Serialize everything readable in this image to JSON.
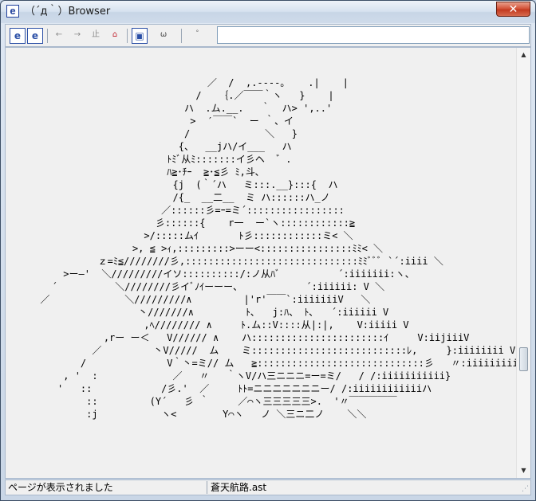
{
  "window": {
    "app_icon_glyph": "e",
    "title": "（´д｀）Browser",
    "close_glyph": "✕"
  },
  "toolbar": {
    "buttons": [
      {
        "name": "page-icon-1",
        "glyph": "e"
      },
      {
        "name": "page-icon-2",
        "glyph": "e"
      },
      {
        "name": "back-icon",
        "glyph": "←"
      },
      {
        "name": "forward-icon",
        "glyph": "→"
      },
      {
        "name": "stop-icon",
        "glyph": "止"
      },
      {
        "name": "home-icon",
        "glyph": "⌂"
      },
      {
        "name": "window-icon",
        "glyph": "▣"
      },
      {
        "name": "face-icon",
        "glyph": "ω"
      },
      {
        "name": "go-icon",
        "glyph": "゜"
      }
    ],
    "address_value": ""
  },
  "content": {
    "ascii_art_lines": [
      "                                   ／  /  ,.‐-‐-｡    .|    |",
      "                                 /   ｛.／￣￣｀ヽ   }    |",
      "                               ハ  .ム.__.   ｀  ハ> ',..'",
      "                                >  ′￣￣`  ー ｀、イ",
      "                               /             ＼   }",
      "                              {、  __jハ/イ___   ハ",
      "                            ﾄﾐﾞ从ﾐ:::::::イ彡ヘ  ゛.",
      "                            ﾊ≧･ﾁｰ  ≧･≦彡 ﾐ,斗､",
      "                             {j  (｀´ハ   ミ:::.__}:::{  ハ",
      "                             /{_  __二__  ミ ハ::::::ハ_ノ",
      "                           ／::::::彡=ｰ=ミ´:::::::::::::::::",
      "                          彡::::::{    r一  ー`ヽ::::::::::::≧",
      "                        >/:::::ムｲ       ﾄ彡::::::::::::ミ< ＼",
      "                      >, ≦ >ｨ,:::::::::>ーー<::::::::::::::::ﾐﾐ< ＼",
      "                ｚ=ﾐ≦////////彡,::::::::::::::::::::::::::::::ﾐﾐﾞﾞﾞ `´:iiii ＼",
      "          >ー―'  ＼/////////イソ::::::::::/:ノ从ﾊﾞ          ´:iiiiiii:ヽ、",
      "        ´          ＼////////彡イﾞﾉｲーーー、           ´:iiiiii: V ＼",
      "      ／             ＼/////////∧         |'r'￣￣`:iiiiiiiV   ＼",
      "                       丶///////∧         ﾄ､   j:ﾊ、 ﾄ､   ´:iiiiii V",
      "                        ,ﾍ//////// ∧     ﾄ.ム::V::::从|:|,    V:iiiii V",
      "                 ,rー ー＜   V////// ∧    ハ:::::::::::::::::::::::ｲ     V:iijiiiV",
      "               ／         丶V/////  ム    ミ:::::::::::::::::::::::::::ﾚ,     }:iiiiiiii V",
      "             /              V｀丶=ミ// ム   ≧:::::::::::::::::::::::::::::彡   〃:iiiiiiiiii:V",
      "          , '  :             ／   〃   ｀ヽV/ハ三ニニニ=ー=ミ/   / /:iiiiiiiiiii}",
      "         '   ::            /彡.'  ／     ﾄﾄ=ニニニニニニニー/ /:iiiiiiiiiiiiハ",
      "              ::         (Y´   彡 ｀     ／⌒ヽ三三三三三>.  '〃￣￣￣￣￣",
      "              :j           ヽ<        Y⌒ヽ   ノ ＼三ニ二ノ    ＼＼"
    ]
  },
  "statusbar": {
    "message": "ページが表示されました",
    "filename": "蒼天航路.ast"
  }
}
